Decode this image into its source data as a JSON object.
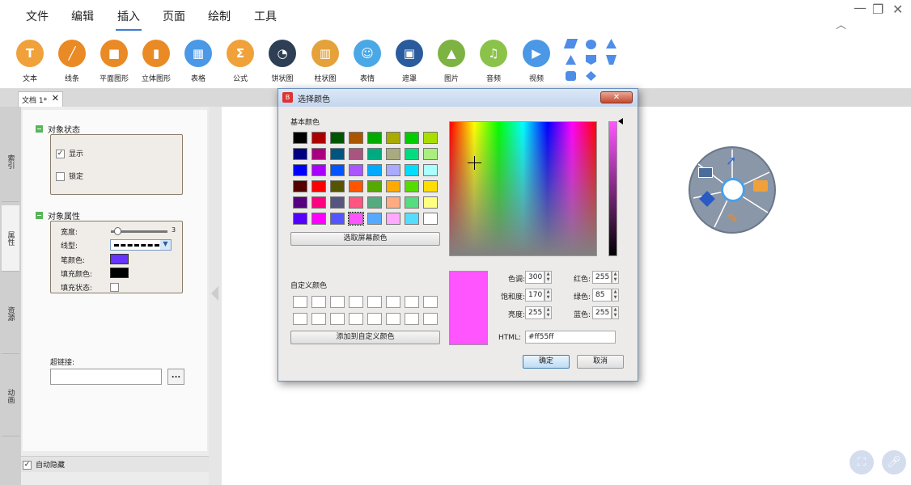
{
  "menubar": {
    "items": [
      "文件",
      "编辑",
      "插入",
      "页面",
      "绘制",
      "工具"
    ],
    "active": "插入"
  },
  "ribbon": {
    "items": [
      {
        "label": "文本",
        "icon": "text-icon",
        "color": "#f0a13a"
      },
      {
        "label": "线条",
        "icon": "line-icon",
        "color": "#ea8a25"
      },
      {
        "label": "平面图形",
        "icon": "plane-shape-icon",
        "color": "#ea8a25"
      },
      {
        "label": "立体图形",
        "icon": "solid-shape-icon",
        "color": "#ea8a25"
      },
      {
        "label": "表格",
        "icon": "table-icon",
        "color": "#4a98e6"
      },
      {
        "label": "公式",
        "icon": "formula-icon",
        "color": "#f0a13a"
      },
      {
        "label": "饼状图",
        "icon": "pie-chart-icon",
        "color": "#2e3f55"
      },
      {
        "label": "柱状图",
        "icon": "bar-chart-icon",
        "color": "#e5a23a"
      },
      {
        "label": "表情",
        "icon": "emoji-icon",
        "color": "#4aa8e6"
      },
      {
        "label": "遮罩",
        "icon": "mask-icon",
        "color": "#2a5b9c"
      },
      {
        "label": "图片",
        "icon": "picture-icon",
        "color": "#7cb342"
      },
      {
        "label": "音频",
        "icon": "audio-icon",
        "color": "#8bc34a"
      },
      {
        "label": "视频",
        "icon": "video-icon",
        "color": "#4a98e6"
      }
    ]
  },
  "doc_tab": {
    "label": "文档 1*"
  },
  "side_tabs": [
    "索引",
    "属性",
    "资源",
    "动画"
  ],
  "panel": {
    "state_title": "对象状态",
    "show_label": "显示",
    "show_checked": true,
    "lock_label": "锁定",
    "lock_checked": false,
    "props_title": "对象属性",
    "width_label": "宽度:",
    "width_value": "3",
    "linetype_label": "线型:",
    "pen_color_label": "笔颜色:",
    "pen_color": "#6633ff",
    "fill_color_label": "填充颜色:",
    "fill_color": "#000000",
    "fill_state_label": "填充状态:",
    "hyperlink_label": "超链接:",
    "more_button": "...",
    "auto_hide_label": "自动隐藏",
    "auto_hide_checked": true
  },
  "dialog": {
    "title": "选择颜色",
    "basic_colors_label": "基本颜色",
    "basic_colors": [
      "#000000",
      "#aa0000",
      "#005500",
      "#aa5500",
      "#00aa00",
      "#aaaa00",
      "#00cc00",
      "#aadd00",
      "#000080",
      "#aa0080",
      "#005580",
      "#aa5580",
      "#00aa80",
      "#aaaa80",
      "#00dd80",
      "#aaee80",
      "#0000ff",
      "#aa00ff",
      "#0055ff",
      "#aa55ff",
      "#00aaff",
      "#aaaaff",
      "#00ddff",
      "#aaffff",
      "#550000",
      "#ff0000",
      "#555500",
      "#ff5500",
      "#55aa00",
      "#ffaa00",
      "#55dd00",
      "#ffdd00",
      "#550080",
      "#ff0080",
      "#555580",
      "#ff5580",
      "#55aa80",
      "#ffaa80",
      "#55dd80",
      "#ffff80",
      "#5500ff",
      "#ff00ff",
      "#5555ff",
      "#ff55ff",
      "#55aaff",
      "#ffaaff",
      "#55ddff",
      "#ffffff"
    ],
    "selected_basic_index": 43,
    "pick_screen_button": "选取屏幕颜色",
    "custom_colors_label": "自定义颜色",
    "add_custom_button": "添加到自定义颜色",
    "preview_color": "#ff55ff",
    "hue_label": "色调:",
    "hue": "300",
    "sat_label": "饱和度:",
    "sat": "170",
    "lum_label": "亮度:",
    "lum": "255",
    "red_label": "红色:",
    "red": "255",
    "green_label": "绿色:",
    "green": "85",
    "blue_label": "蓝色:",
    "blue": "255",
    "html_label": "HTML:",
    "html": "#ff55ff",
    "ok_button": "确定",
    "cancel_button": "取消"
  }
}
